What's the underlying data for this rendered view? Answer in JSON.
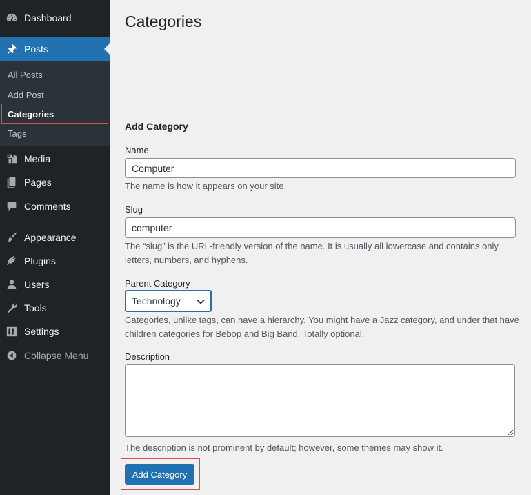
{
  "sidebar": {
    "items": [
      {
        "label": "Dashboard",
        "icon": "dashboard-icon"
      },
      {
        "label": "Posts",
        "icon": "pin-icon",
        "active": true
      },
      {
        "label": "Media",
        "icon": "media-icon"
      },
      {
        "label": "Pages",
        "icon": "pages-icon"
      },
      {
        "label": "Comments",
        "icon": "comments-icon"
      },
      {
        "label": "Appearance",
        "icon": "brush-icon"
      },
      {
        "label": "Plugins",
        "icon": "plugin-icon"
      },
      {
        "label": "Users",
        "icon": "user-icon"
      },
      {
        "label": "Tools",
        "icon": "wrench-icon"
      },
      {
        "label": "Settings",
        "icon": "settings-icon"
      }
    ],
    "submenu": [
      {
        "label": "All Posts"
      },
      {
        "label": "Add Post"
      },
      {
        "label": "Categories",
        "current": true
      },
      {
        "label": "Tags"
      }
    ],
    "collapse_label": "Collapse Menu"
  },
  "main": {
    "title": "Categories",
    "form_heading": "Add Category",
    "name": {
      "label": "Name",
      "value": "Computer",
      "help": "The name is how it appears on your site."
    },
    "slug": {
      "label": "Slug",
      "value": "computer",
      "help": "The “slug” is the URL-friendly version of the name. It is usually all lowercase and contains only letters, numbers, and hyphens."
    },
    "parent": {
      "label": "Parent Category",
      "selected": "Technology",
      "help": "Categories, unlike tags, can have a hierarchy. You might have a Jazz category, and under that have children categories for Bebop and Big Band. Totally optional."
    },
    "description": {
      "label": "Description",
      "value": "",
      "help": "The description is not prominent by default; however, some themes may show it."
    },
    "submit_label": "Add Category"
  },
  "colors": {
    "sidebar_bg": "#1d2327",
    "submenu_bg": "#2c3338",
    "accent": "#2271b1",
    "page_bg": "#f0f0f1",
    "highlight": "#e04a4a"
  }
}
